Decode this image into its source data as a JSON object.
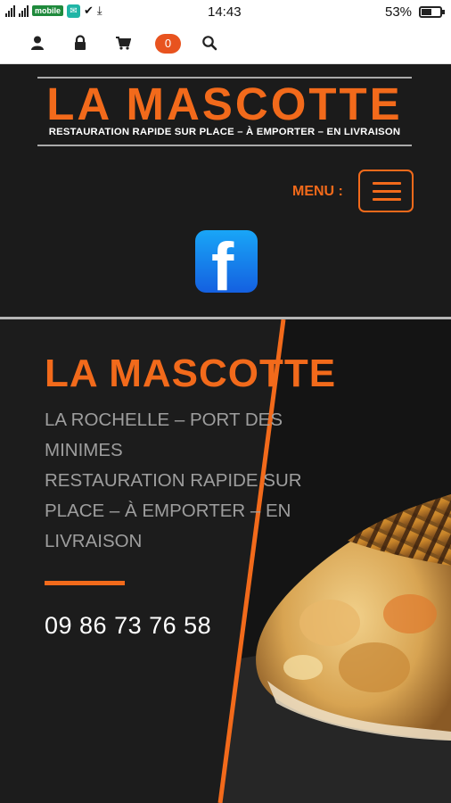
{
  "status_bar": {
    "network_label": "mobile",
    "time": "14:43",
    "battery": "53%",
    "battery_level": 0.53
  },
  "toolbar": {
    "icons": [
      "user-icon",
      "lock-icon",
      "cart-icon",
      "search-icon"
    ],
    "cart_count": "0"
  },
  "header": {
    "logo_title": "LA MASCOTTE",
    "logo_subtitle": "RESTAURATION RAPIDE SUR PLACE – À EMPORTER – EN LIVRAISON",
    "menu_label": "MENU :",
    "social": "facebook-icon"
  },
  "hero": {
    "title": "LA MASCOTTE",
    "lines": [
      "LA ROCHELLE – PORT DES",
      "MINIMES",
      "RESTAURATION RAPIDE SUR",
      "PLACE – À EMPORTER – EN",
      "LIVRAISON"
    ],
    "phone": "09 86 73 76 58"
  },
  "colors": {
    "accent": "#f26a1b",
    "background": "#1b1b1b",
    "facebook": "#1877f2"
  }
}
